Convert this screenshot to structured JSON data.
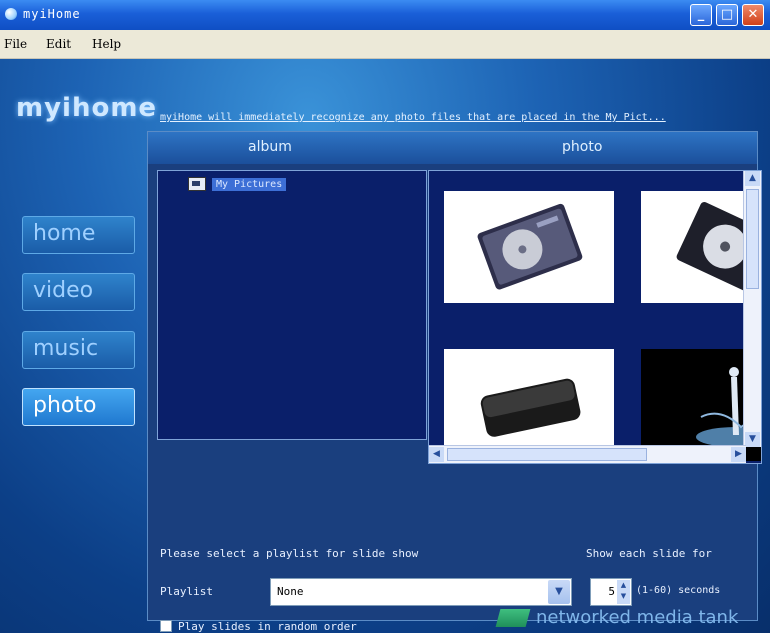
{
  "window": {
    "title": "myiHome"
  },
  "menu": {
    "items": [
      "File",
      "Edit",
      "Help"
    ]
  },
  "logo": {
    "text": "myihome"
  },
  "banner": {
    "text": "myiHome will immediately recognize any photo files that are placed in the My Pict..."
  },
  "nav": {
    "items": [
      "home",
      "video",
      "music",
      "photo"
    ],
    "active": "photo"
  },
  "panel": {
    "album_header": "album",
    "photo_header": "photo",
    "album_items": [
      "My Pictures"
    ]
  },
  "slideshow": {
    "select_label": "Please select a playlist for slide show",
    "show_each_label": "Show each slide for",
    "playlist_label": "Playlist",
    "playlist_value": "None",
    "seconds_value": "5",
    "seconds_range": "(1-60) seconds",
    "random_label": "Play slides in random order"
  },
  "footer": {
    "brand": "networked media tank"
  },
  "colors": {
    "accent": "#1f78cf",
    "panel": "#0a1f6a",
    "brand_green": "#3fbf7f"
  }
}
